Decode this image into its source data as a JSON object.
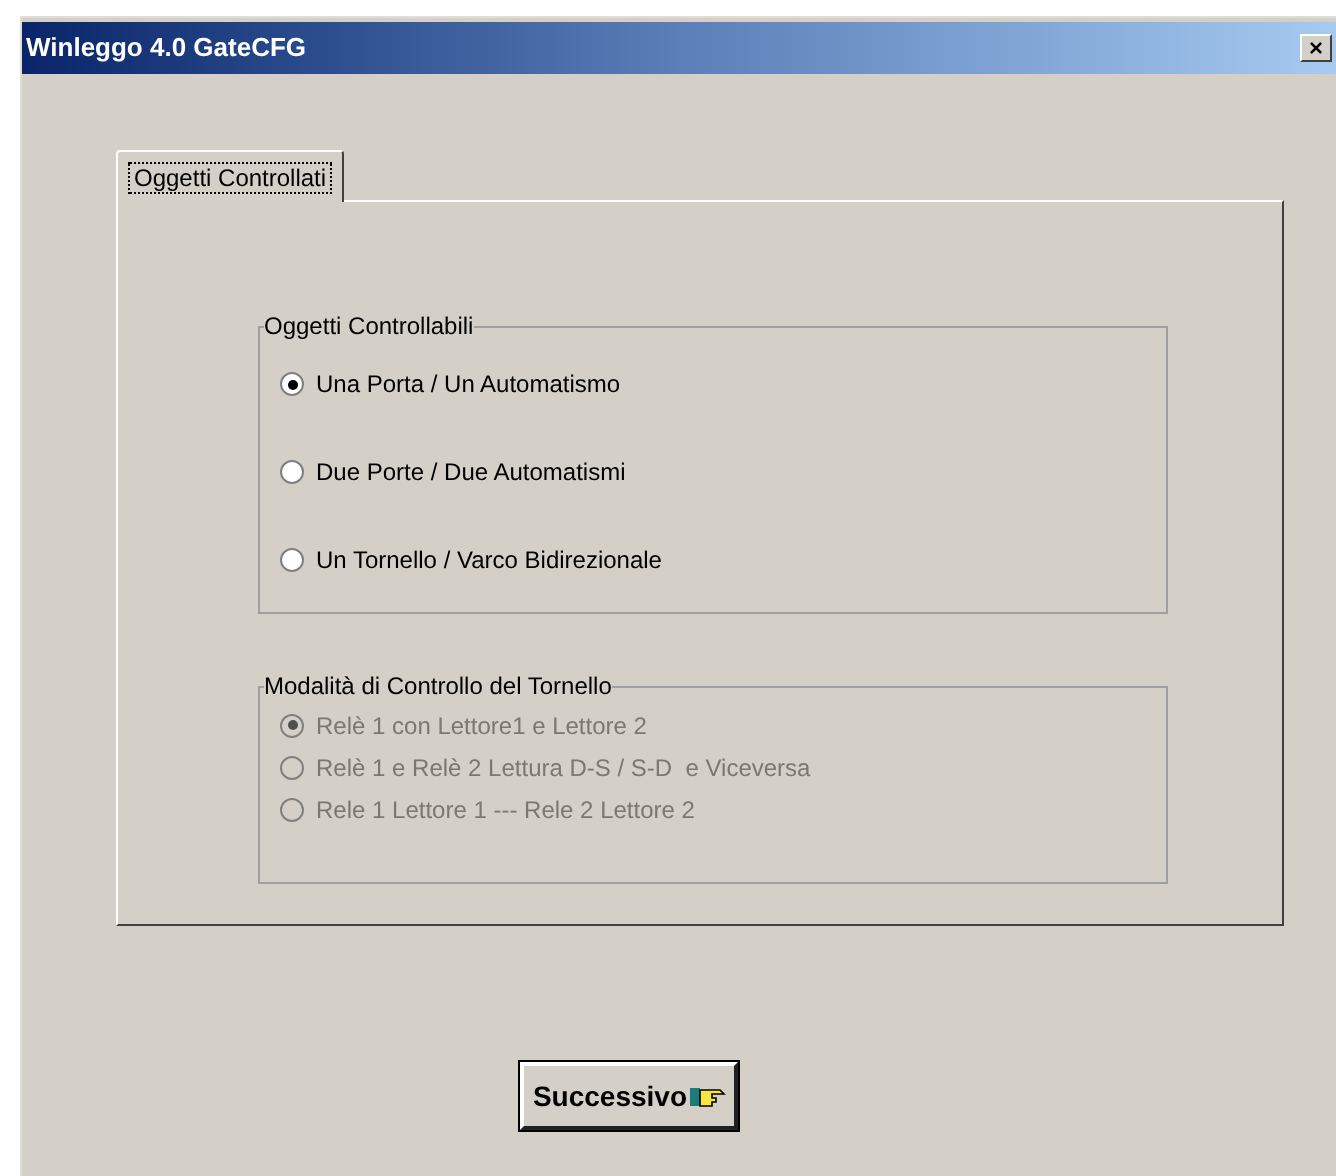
{
  "window": {
    "title": "Winleggo 4.0 GateCFG",
    "close": "×"
  },
  "tabs": [
    {
      "label": "Oggetti Controllati",
      "selected": true
    }
  ],
  "groups": [
    {
      "title": "Oggetti Controllabili",
      "disabled": false,
      "options": [
        {
          "label": "Una Porta / Un Automatismo",
          "selected": true
        },
        {
          "label": "Due Porte / Due Automatismi",
          "selected": false
        },
        {
          "label": "Un Tornello / Varco Bidirezionale",
          "selected": false
        }
      ]
    },
    {
      "title": "Modalità di Controllo del Tornello",
      "disabled": true,
      "options": [
        {
          "label": "Relè 1 con Lettore1 e Lettore 2",
          "selected": true
        },
        {
          "label": "Relè 1 e Relè 2 Lettura D-S / S-D  e Viceversa",
          "selected": false
        },
        {
          "label": "Rele 1 Lettore 1 --- Rele 2 Lettore 2",
          "selected": false
        }
      ]
    }
  ],
  "next_button": {
    "label": "Successivo"
  }
}
